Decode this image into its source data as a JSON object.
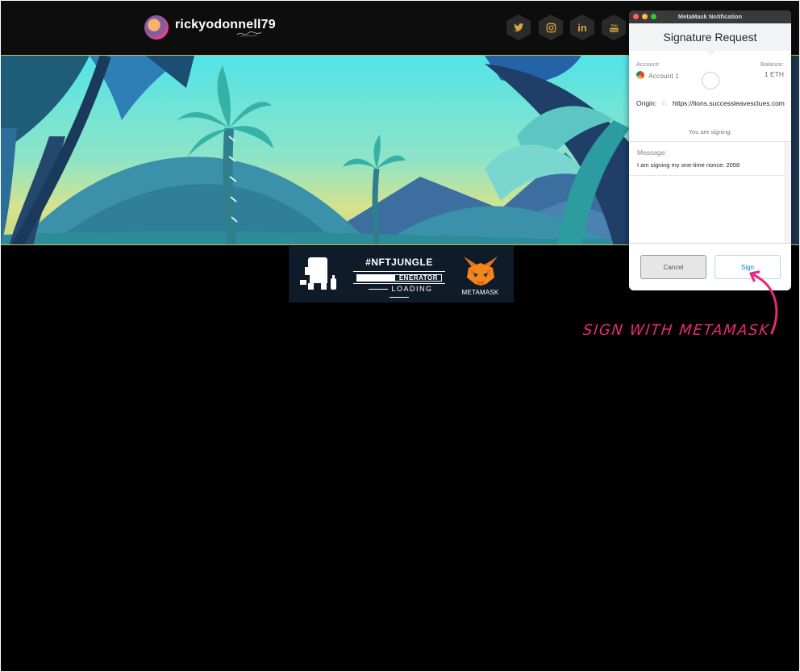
{
  "header": {
    "username": "rickyodonnell79",
    "social_icons": [
      {
        "name": "twitter-icon",
        "glyph": "🐦"
      },
      {
        "name": "instagram-icon",
        "glyph": "◎"
      },
      {
        "name": "linkedin-icon",
        "glyph": "in"
      },
      {
        "name": "youtube-icon",
        "glyph": "You"
      }
    ]
  },
  "loader": {
    "hashtag": "#NFTJUNGLE",
    "bar_text": "ENERATOR",
    "progress": 0.45,
    "status": "LOADING",
    "metamask_label": "METAMASK"
  },
  "popup": {
    "window_title": "MetaMask Notification",
    "title": "Signature Request",
    "account_label": "Account:",
    "account_name": "Account 1",
    "balance_label": "Balance:",
    "balance_value": "1 ETH",
    "origin_label": "Origin:",
    "origin_url": "https://lions.successleavesclues.com",
    "signing_label": "You are signing:",
    "message_label": "Message:",
    "message_text": "I am signing my one-time nonce: 2058",
    "cancel_label": "Cancel",
    "sign_label": "Sign"
  },
  "annotation": {
    "text": "SIGN WITH METAMASK",
    "color": "#e8287a"
  },
  "colors": {
    "accent_gold": "#d8a53a",
    "metamask_blue": "#037dd6"
  }
}
